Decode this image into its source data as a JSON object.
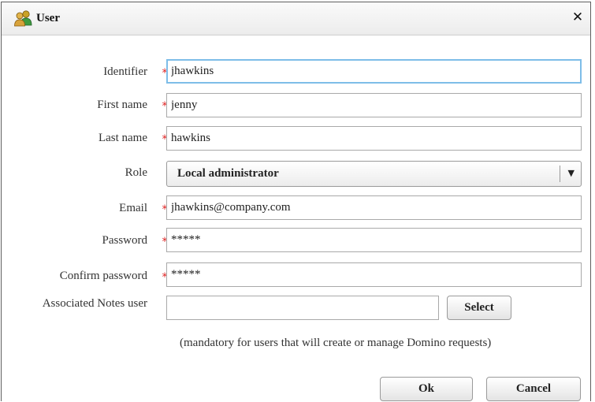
{
  "dialog": {
    "title": "User"
  },
  "form": {
    "identifier": {
      "label": "Identifier",
      "value": "jhawkins"
    },
    "first_name": {
      "label": "First name",
      "value": "jenny"
    },
    "last_name": {
      "label": "Last name",
      "value": "hawkins"
    },
    "role": {
      "label": "Role",
      "value": "Local administrator"
    },
    "email": {
      "label": "Email",
      "value": "jhawkins@company.com"
    },
    "password": {
      "label": "Password",
      "value": "*****"
    },
    "confirm_password": {
      "label": "Confirm password",
      "value": "*****"
    },
    "notes_user": {
      "label": "Associated Notes user",
      "value": "",
      "button": "Select"
    },
    "required_marker": "*",
    "hint": "(mandatory for users that will create or manage Domino requests)"
  },
  "buttons": {
    "ok": "Ok",
    "cancel": "Cancel"
  },
  "icons": {
    "title": "users-icon",
    "close": "close-icon",
    "dropdown": "chevron-down-icon"
  },
  "colors": {
    "required": "#dd2222",
    "focus": "#7ebde8"
  }
}
